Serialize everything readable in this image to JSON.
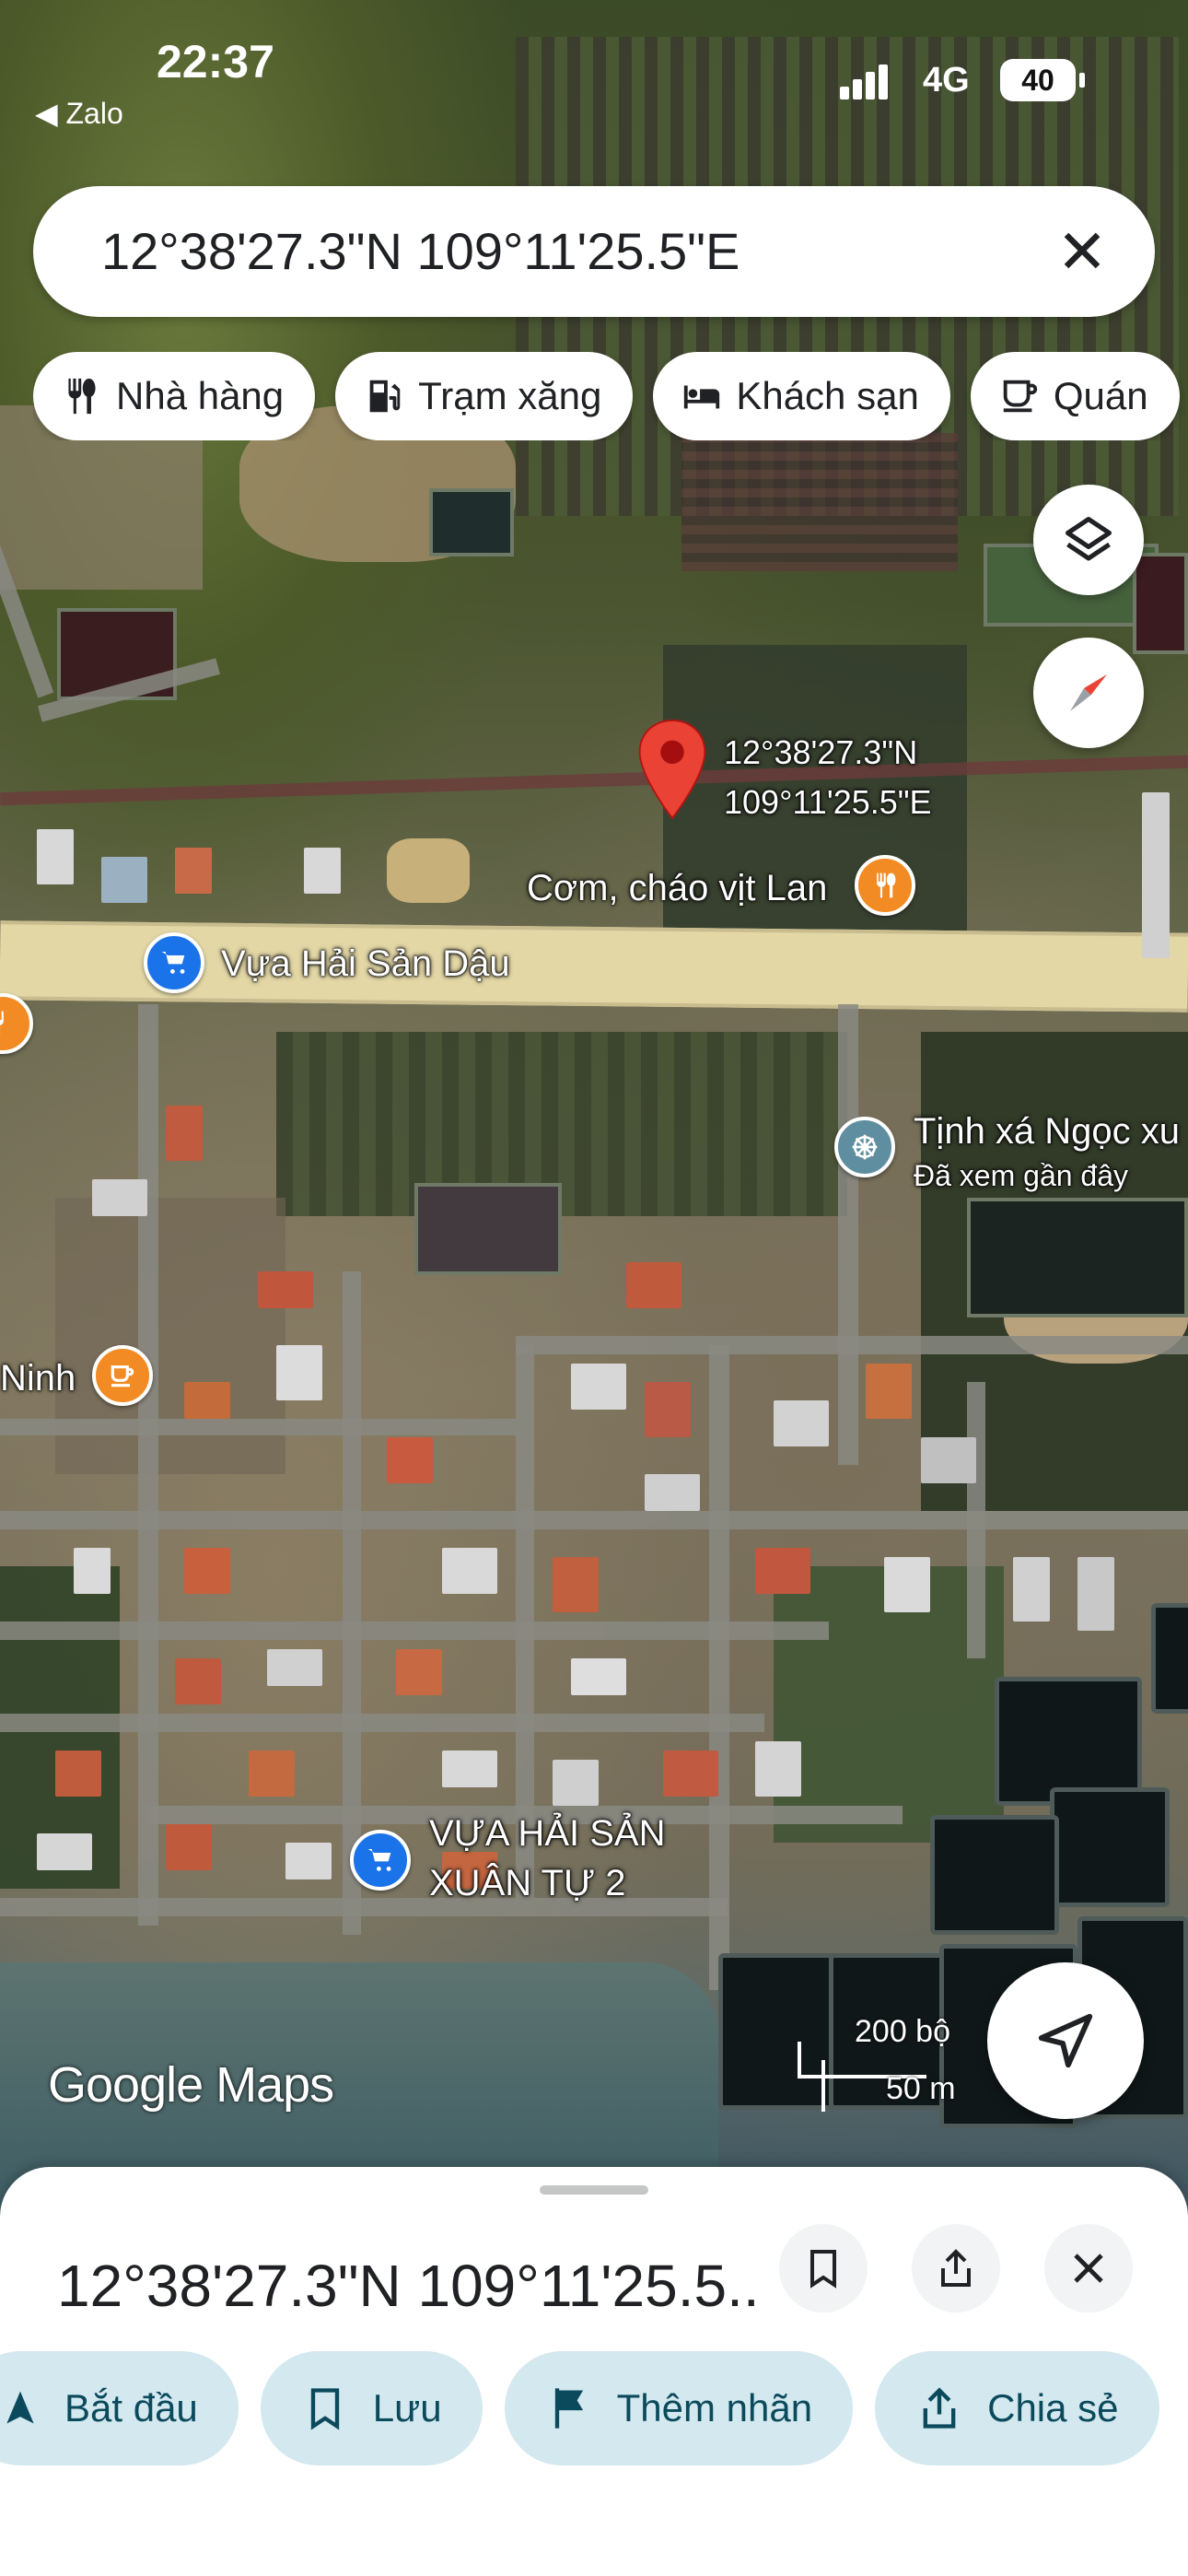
{
  "status_bar": {
    "time": "22:37",
    "back_app": "◀ Zalo",
    "network": "4G",
    "battery": "40"
  },
  "search": {
    "value": "12°38'27.3\"N 109°11'25.5\"E",
    "clear_icon": "close-icon"
  },
  "chips": [
    {
      "label": "Nhà hàng",
      "icon": "restaurant-icon"
    },
    {
      "label": "Trạm xăng",
      "icon": "gas-station-icon"
    },
    {
      "label": "Khách sạn",
      "icon": "hotel-icon"
    },
    {
      "label": "Quán",
      "icon": "cafe-icon"
    }
  ],
  "map": {
    "pin_label": {
      "line1": "12°38'27.3\"N",
      "line2": "109°11'25.5\"E"
    },
    "places": {
      "com_chao": "Cơm, cháo vịt Lan",
      "vua_dau": "Vựa Hải Sản Dậu",
      "tinh_xa": "Tịnh xá Ngọc xu",
      "tinh_xa_sub": "Đã xem gần đây",
      "ninh": "Ninh",
      "vua_xuan_tu_1": "VỰA HẢI SẢN",
      "vua_xuan_tu_2": "XUÂN TỰ 2"
    },
    "brand": "Google Maps",
    "scale": {
      "feet": "200 bộ",
      "meters": "50 m"
    },
    "colors": {
      "pin": "#ea4335",
      "food_poi": "#f28b24",
      "shop_poi": "#1a73e8",
      "temple_poi": "#5f8ea0"
    }
  },
  "sheet": {
    "title": "12°38'27.3\"N 109°11'25.5...",
    "actions": [
      {
        "label": "Bắt đầu",
        "icon": "navigation-icon"
      },
      {
        "label": "Lưu",
        "icon": "bookmark-icon"
      },
      {
        "label": "Thêm nhãn",
        "icon": "flag-icon"
      },
      {
        "label": "Chia sẻ",
        "icon": "share-icon"
      }
    ],
    "accent": "#d3e8ef"
  }
}
